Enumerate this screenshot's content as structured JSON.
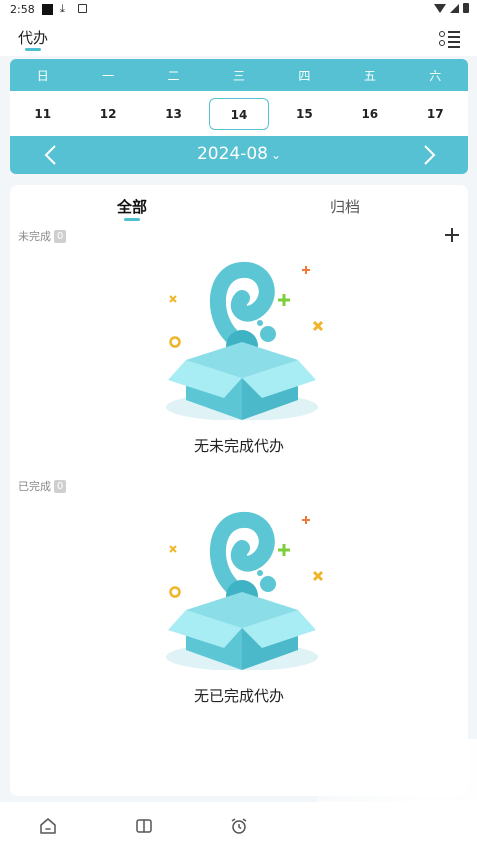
{
  "status_bar": {
    "time": "2:58",
    "download_glyph": "⤓"
  },
  "header": {
    "title": "代办"
  },
  "calendar": {
    "weekdays": [
      "日",
      "一",
      "二",
      "三",
      "四",
      "五",
      "六"
    ],
    "dates": [
      "11",
      "12",
      "13",
      "14",
      "15",
      "16",
      "17"
    ],
    "selected_date": "14",
    "month": "2024-08",
    "accent": "#56c1d3"
  },
  "tabs": [
    {
      "label": "全部",
      "active": true
    },
    {
      "label": "归档",
      "active": false
    }
  ],
  "sections": {
    "pending": {
      "label": "未完成",
      "count": "0",
      "empty_text": "无未完成代办"
    },
    "done": {
      "label": "已完成",
      "count": "0",
      "empty_text": "无已完成代办"
    }
  },
  "icons": {
    "menu": "list-menu-icon",
    "add": "plus-icon",
    "nav_home": "home-icon",
    "nav_book": "book-icon",
    "nav_alarm": "alarm-clock-icon"
  }
}
